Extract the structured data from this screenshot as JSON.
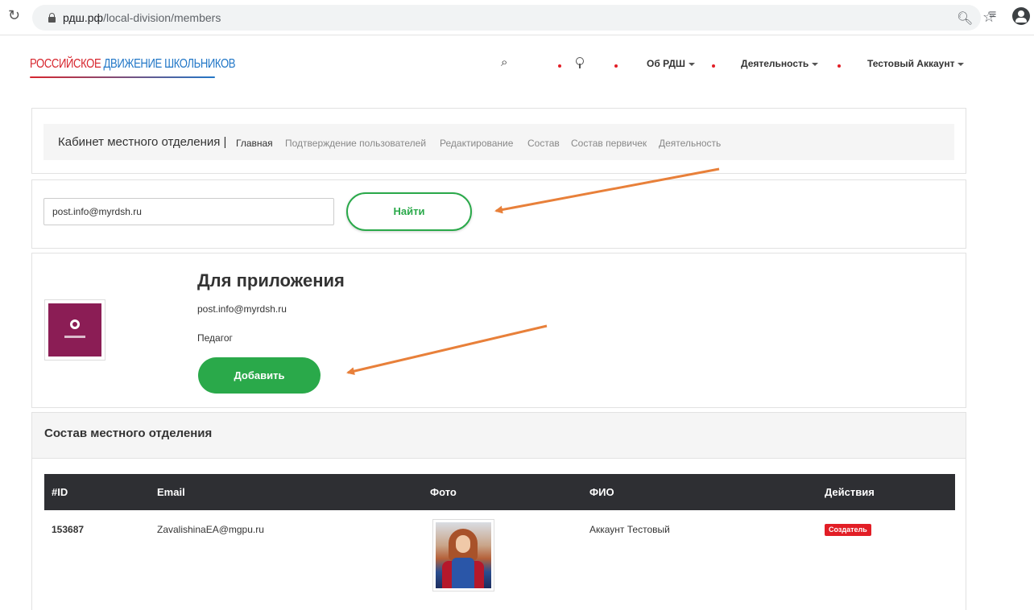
{
  "browser": {
    "url_host": "рдш.рф",
    "url_path": "/local-division/members",
    "icons": [
      "reload-icon",
      "lock-icon",
      "zoom-icon",
      "star-icon",
      "queue-icon",
      "profile-icon"
    ]
  },
  "header": {
    "logo_part1": "РОССИЙСКОЕ ",
    "logo_part2": "ДВИЖЕНИЕ ШКОЛЬНИКОВ",
    "nav": {
      "about": "Об РДШ",
      "activity": "Деятельность",
      "account": "Тестовый Аккаунт"
    },
    "accent_color": "#e21e26"
  },
  "cabinet": {
    "title": "Кабинет местного отделения |",
    "tabs": [
      {
        "label": "Главная",
        "active": true
      },
      {
        "label": "Подтверждение пользователей",
        "active": false
      },
      {
        "label": "Редактирование",
        "active": false
      },
      {
        "label": "Состав",
        "active": false
      },
      {
        "label": "Состав первичек",
        "active": false
      },
      {
        "label": "Деятельность",
        "active": false
      }
    ]
  },
  "search": {
    "value": "post.info@myrdsh.ru",
    "button_label": "Найти"
  },
  "found_user": {
    "name": "Для приложения",
    "email": "post.info@myrdsh.ru",
    "role": "Педагог",
    "add_label": "Добавить"
  },
  "members": {
    "title": "Состав местного отделения",
    "columns": [
      "#ID",
      "Email",
      "Фото",
      "ФИО",
      "Действия"
    ],
    "rows": [
      {
        "id": "153687",
        "email": "ZavalishinaEA@mgpu.ru",
        "fio": "Аккаунт Тестовый",
        "action_badge": "Создатель"
      }
    ]
  },
  "colors": {
    "green": "#2aa94a",
    "table_header": "#2e2f33",
    "arrow": "#e8803a"
  }
}
